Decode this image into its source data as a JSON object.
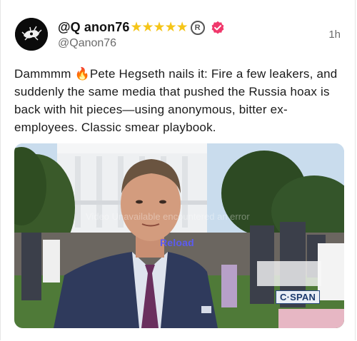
{
  "post": {
    "display_name": "@Q anon76",
    "badge_stars": "★★★★★",
    "registered_mark": "R",
    "handle": "@Qanon76",
    "timestamp": "1h",
    "text": "Dammmm 🔥Pete Hegseth nails it: Fire a few leakers, and suddenly the same media that pushed the Russia hoax is back with hit pieces—using anonymous, bitter ex-employees. Classic smear playbook."
  },
  "media": {
    "reload_label": "Reload",
    "overlay_text": "Video Unavailable encountered an error",
    "network_logo": "C·SPAN"
  },
  "colors": {
    "verified_badge": "#f0386b",
    "star": "#f5c518",
    "handle_text": "#6b6b6b",
    "reload_link": "#5b5bf0"
  },
  "icons": {
    "avatar": "black-white-logo-avatar",
    "verified": "verified-badge-icon"
  }
}
